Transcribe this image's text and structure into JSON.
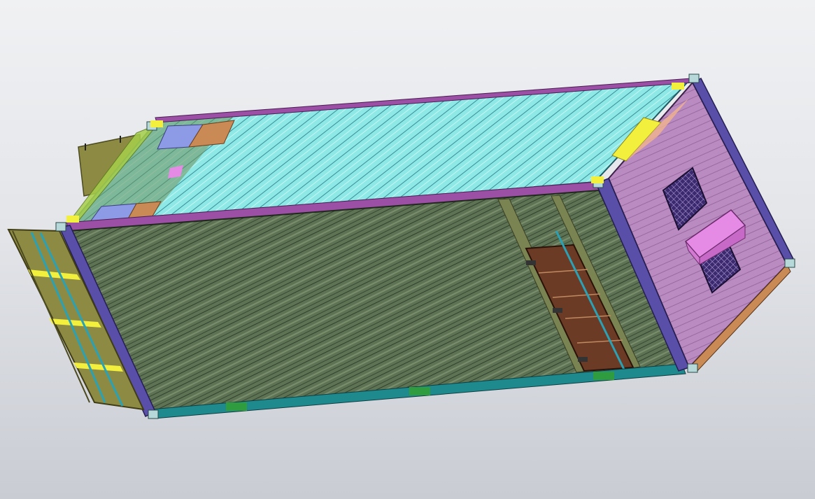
{
  "viewport": {
    "background_top": "#f0f1f3",
    "background_bottom": "#c9ccd3"
  },
  "model": {
    "description_colors": {
      "roof": "#8ee8e6",
      "roof_stripe": "#2e7f86",
      "side_wall": "#5e7354",
      "side_wall_rib": "#2f3f2c",
      "end_wall": "#b98bc0",
      "end_frame": "#5a4fa8",
      "top_rail": "#9b4fa5",
      "bottom_rail": "#1f8a8e",
      "open_door": "#8d8b43",
      "door_bars": "#2aa1b4",
      "side_door": "#6b3b26",
      "vent_box": "#e58ae5",
      "vent_grille": "#3c2a6e",
      "corner_fitting": "#b7d8d8",
      "yellow_block": "#f3ef3d",
      "peach_block": "#f2b48c",
      "blue_block": "#8d9be6",
      "green_fork_pad": "#2f9d3f"
    }
  }
}
